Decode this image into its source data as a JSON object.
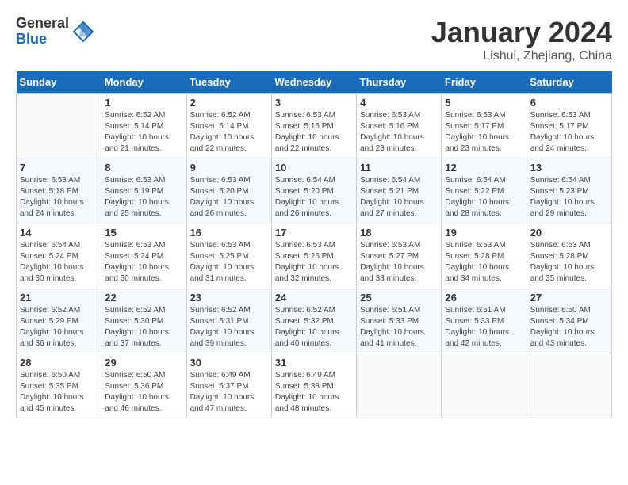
{
  "logo": {
    "general": "General",
    "blue": "Blue"
  },
  "title": "January 2024",
  "subtitle": "Lishui, Zhejiang, China",
  "days_of_week": [
    "Sunday",
    "Monday",
    "Tuesday",
    "Wednesday",
    "Thursday",
    "Friday",
    "Saturday"
  ],
  "weeks": [
    [
      {
        "day": "",
        "info": ""
      },
      {
        "day": "1",
        "info": "Sunrise: 6:52 AM\nSunset: 5:14 PM\nDaylight: 10 hours\nand 21 minutes."
      },
      {
        "day": "2",
        "info": "Sunrise: 6:52 AM\nSunset: 5:14 PM\nDaylight: 10 hours\nand 22 minutes."
      },
      {
        "day": "3",
        "info": "Sunrise: 6:53 AM\nSunset: 5:15 PM\nDaylight: 10 hours\nand 22 minutes."
      },
      {
        "day": "4",
        "info": "Sunrise: 6:53 AM\nSunset: 5:16 PM\nDaylight: 10 hours\nand 23 minutes."
      },
      {
        "day": "5",
        "info": "Sunrise: 6:53 AM\nSunset: 5:17 PM\nDaylight: 10 hours\nand 23 minutes."
      },
      {
        "day": "6",
        "info": "Sunrise: 6:53 AM\nSunset: 5:17 PM\nDaylight: 10 hours\nand 24 minutes."
      }
    ],
    [
      {
        "day": "7",
        "info": "Sunrise: 6:53 AM\nSunset: 5:18 PM\nDaylight: 10 hours\nand 24 minutes."
      },
      {
        "day": "8",
        "info": "Sunrise: 6:53 AM\nSunset: 5:19 PM\nDaylight: 10 hours\nand 25 minutes."
      },
      {
        "day": "9",
        "info": "Sunrise: 6:53 AM\nSunset: 5:20 PM\nDaylight: 10 hours\nand 26 minutes."
      },
      {
        "day": "10",
        "info": "Sunrise: 6:54 AM\nSunset: 5:20 PM\nDaylight: 10 hours\nand 26 minutes."
      },
      {
        "day": "11",
        "info": "Sunrise: 6:54 AM\nSunset: 5:21 PM\nDaylight: 10 hours\nand 27 minutes."
      },
      {
        "day": "12",
        "info": "Sunrise: 6:54 AM\nSunset: 5:22 PM\nDaylight: 10 hours\nand 28 minutes."
      },
      {
        "day": "13",
        "info": "Sunrise: 6:54 AM\nSunset: 5:23 PM\nDaylight: 10 hours\nand 29 minutes."
      }
    ],
    [
      {
        "day": "14",
        "info": "Sunrise: 6:54 AM\nSunset: 5:24 PM\nDaylight: 10 hours\nand 30 minutes."
      },
      {
        "day": "15",
        "info": "Sunrise: 6:53 AM\nSunset: 5:24 PM\nDaylight: 10 hours\nand 30 minutes."
      },
      {
        "day": "16",
        "info": "Sunrise: 6:53 AM\nSunset: 5:25 PM\nDaylight: 10 hours\nand 31 minutes."
      },
      {
        "day": "17",
        "info": "Sunrise: 6:53 AM\nSunset: 5:26 PM\nDaylight: 10 hours\nand 32 minutes."
      },
      {
        "day": "18",
        "info": "Sunrise: 6:53 AM\nSunset: 5:27 PM\nDaylight: 10 hours\nand 33 minutes."
      },
      {
        "day": "19",
        "info": "Sunrise: 6:53 AM\nSunset: 5:28 PM\nDaylight: 10 hours\nand 34 minutes."
      },
      {
        "day": "20",
        "info": "Sunrise: 6:53 AM\nSunset: 5:28 PM\nDaylight: 10 hours\nand 35 minutes."
      }
    ],
    [
      {
        "day": "21",
        "info": "Sunrise: 6:52 AM\nSunset: 5:29 PM\nDaylight: 10 hours\nand 36 minutes."
      },
      {
        "day": "22",
        "info": "Sunrise: 6:52 AM\nSunset: 5:30 PM\nDaylight: 10 hours\nand 37 minutes."
      },
      {
        "day": "23",
        "info": "Sunrise: 6:52 AM\nSunset: 5:31 PM\nDaylight: 10 hours\nand 39 minutes."
      },
      {
        "day": "24",
        "info": "Sunrise: 6:52 AM\nSunset: 5:32 PM\nDaylight: 10 hours\nand 40 minutes."
      },
      {
        "day": "25",
        "info": "Sunrise: 6:51 AM\nSunset: 5:33 PM\nDaylight: 10 hours\nand 41 minutes."
      },
      {
        "day": "26",
        "info": "Sunrise: 6:51 AM\nSunset: 5:33 PM\nDaylight: 10 hours\nand 42 minutes."
      },
      {
        "day": "27",
        "info": "Sunrise: 6:50 AM\nSunset: 5:34 PM\nDaylight: 10 hours\nand 43 minutes."
      }
    ],
    [
      {
        "day": "28",
        "info": "Sunrise: 6:50 AM\nSunset: 5:35 PM\nDaylight: 10 hours\nand 45 minutes."
      },
      {
        "day": "29",
        "info": "Sunrise: 6:50 AM\nSunset: 5:36 PM\nDaylight: 10 hours\nand 46 minutes."
      },
      {
        "day": "30",
        "info": "Sunrise: 6:49 AM\nSunset: 5:37 PM\nDaylight: 10 hours\nand 47 minutes."
      },
      {
        "day": "31",
        "info": "Sunrise: 6:49 AM\nSunset: 5:38 PM\nDaylight: 10 hours\nand 48 minutes."
      },
      {
        "day": "",
        "info": ""
      },
      {
        "day": "",
        "info": ""
      },
      {
        "day": "",
        "info": ""
      }
    ]
  ]
}
